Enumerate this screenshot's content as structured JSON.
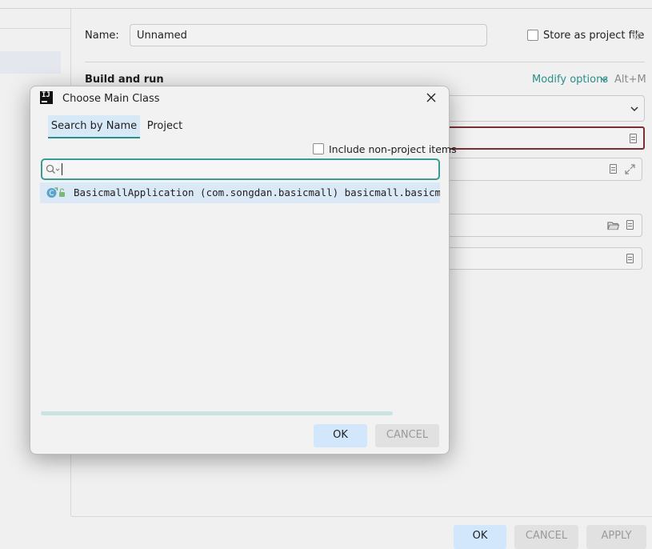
{
  "main": {
    "name_label": "Name:",
    "name_value": "Unnamed",
    "store_label": "Store as project file",
    "section_title": "Build and run",
    "modify_options": "Modify options",
    "modify_shortcut": "Alt+M"
  },
  "footer": {
    "ok": "OK",
    "cancel": "CANCEL",
    "apply": "APPLY"
  },
  "dialog": {
    "title": "Choose Main Class",
    "logo_text": "IJ",
    "tabs": [
      "Search by Name",
      "Project"
    ],
    "include_label": "Include non-project items",
    "search_value": "",
    "results": [
      {
        "text": "BasicmallApplication (com.songdan.basicmall) basicmall.basicmall.main"
      }
    ],
    "ok": "OK",
    "cancel": "CANCEL"
  },
  "icons": {
    "gear": "gear-icon",
    "chevron": "chevron-down-icon",
    "doc": "document-icon",
    "folder": "folder-icon",
    "expand": "expand-icon",
    "close": "close-icon",
    "search": "search-icon",
    "class": "class-icon"
  },
  "colors": {
    "accent": "#2a8f8a",
    "error_border": "#7a2f35",
    "primary_button": "#d2e7fb"
  }
}
